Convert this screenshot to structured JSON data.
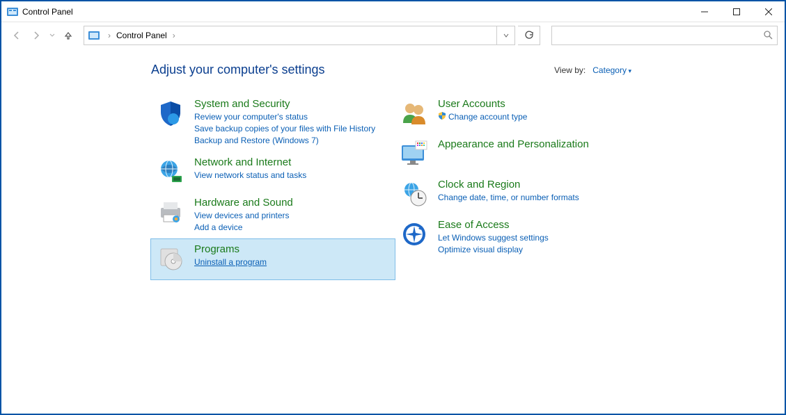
{
  "titlebar": {
    "title": "Control Panel"
  },
  "nav": {
    "crumb1": "Control Panel"
  },
  "header": {
    "title": "Adjust your computer's settings",
    "viewby_label": "View by:",
    "viewby_value": "Category"
  },
  "left": [
    {
      "title": "System and Security",
      "links": [
        "Review your computer's status",
        "Save backup copies of your files with File History",
        "Backup and Restore (Windows 7)"
      ]
    },
    {
      "title": "Network and Internet",
      "links": [
        "View network status and tasks"
      ]
    },
    {
      "title": "Hardware and Sound",
      "links": [
        "View devices and printers",
        "Add a device"
      ]
    },
    {
      "title": "Programs",
      "links": [
        "Uninstall a program"
      ],
      "selected": true
    }
  ],
  "right": [
    {
      "title": "User Accounts",
      "links": [
        "Change account type"
      ],
      "shields": [
        true
      ]
    },
    {
      "title": "Appearance and Personalization",
      "links": []
    },
    {
      "title": "Clock and Region",
      "links": [
        "Change date, time, or number formats"
      ]
    },
    {
      "title": "Ease of Access",
      "links": [
        "Let Windows suggest settings",
        "Optimize visual display"
      ]
    }
  ]
}
